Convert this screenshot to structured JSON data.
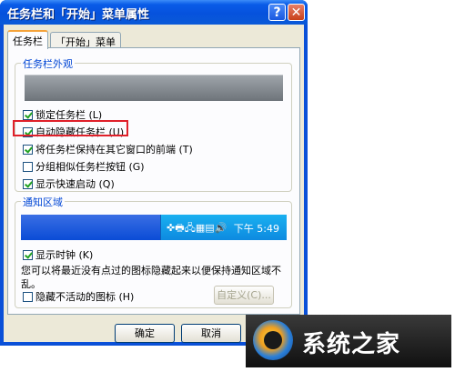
{
  "window": {
    "title": "任务栏和「开始」菜单属性",
    "help_glyph": "?",
    "close_glyph": "✕"
  },
  "tabs": [
    {
      "label": "任务栏"
    },
    {
      "label": "「开始」菜单"
    }
  ],
  "appearance": {
    "group_label": "任务栏外观",
    "options": [
      {
        "label": "锁定任务栏 (L)",
        "checked": true
      },
      {
        "label": "自动隐藏任务栏 (U)",
        "checked": true
      },
      {
        "label": "将任务栏保持在其它窗口的前端 (T)",
        "checked": true
      },
      {
        "label": "分组相似任务栏按钮 (G)",
        "checked": false
      },
      {
        "label": "显示快速启动 (Q)",
        "checked": true
      }
    ]
  },
  "notification": {
    "group_label": "通知区域",
    "tray_icons": "✜🖶🖧▦▤🔊",
    "clock_text": "下午 5:49",
    "show_clock_label": "显示时钟 (K)",
    "description": "您可以将最近没有点过的图标隐藏起来以便保持通知区域不乱。",
    "hide_inactive_label": "隐藏不活动的图标 (H)",
    "customize_button": "自定义(C)..."
  },
  "buttons": {
    "ok": "确定",
    "cancel": "取消",
    "apply": "应"
  },
  "watermark": {
    "text": "系统之家"
  }
}
